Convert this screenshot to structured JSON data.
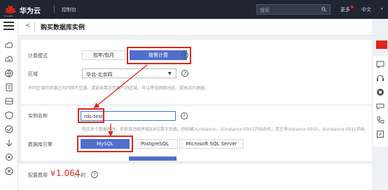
{
  "topbar": {
    "brand_cn": "华为云",
    "brand_en": "HUAWEI",
    "console": "控制台",
    "search_placeholder": "搜索",
    "more": "更多",
    "language": "中文",
    "lang_caret": "▾"
  },
  "header": {
    "back": "<",
    "title": "购买数据库实例"
  },
  "billing": {
    "label": "计费模式",
    "options": [
      "包年/包月",
      "按需计费"
    ],
    "selected": "按需计费"
  },
  "region": {
    "label": "区域",
    "value": "华北-北京四",
    "caret": "▼",
    "hint": "不同区域的资源之间内网不互通。请选择靠近您客户的区域，可以降低网络时延、提高访问速度。"
  },
  "instance_name": {
    "label": "实例名称",
    "value": "rds-test",
    "hint": "购买多个数据库时，名称自动按序增加4位数字后缀。例如输入instance，从instance-0001开始命名；若已有instance-0010，从instance-0011开始"
  },
  "engine": {
    "label": "数据库引擎",
    "options": [
      "MySQL",
      "PostgreSQL",
      "Microsoft SQL Server"
    ],
    "selected": "MySQL"
  },
  "help_symbol": "?",
  "footer": {
    "label": "配置费用",
    "currency": "¥",
    "price": "1.064",
    "unit": "/小时"
  },
  "colors": {
    "accent": "#526ecc",
    "annotation_red": "#e1251b",
    "topbar_bg": "#1f2531"
  }
}
